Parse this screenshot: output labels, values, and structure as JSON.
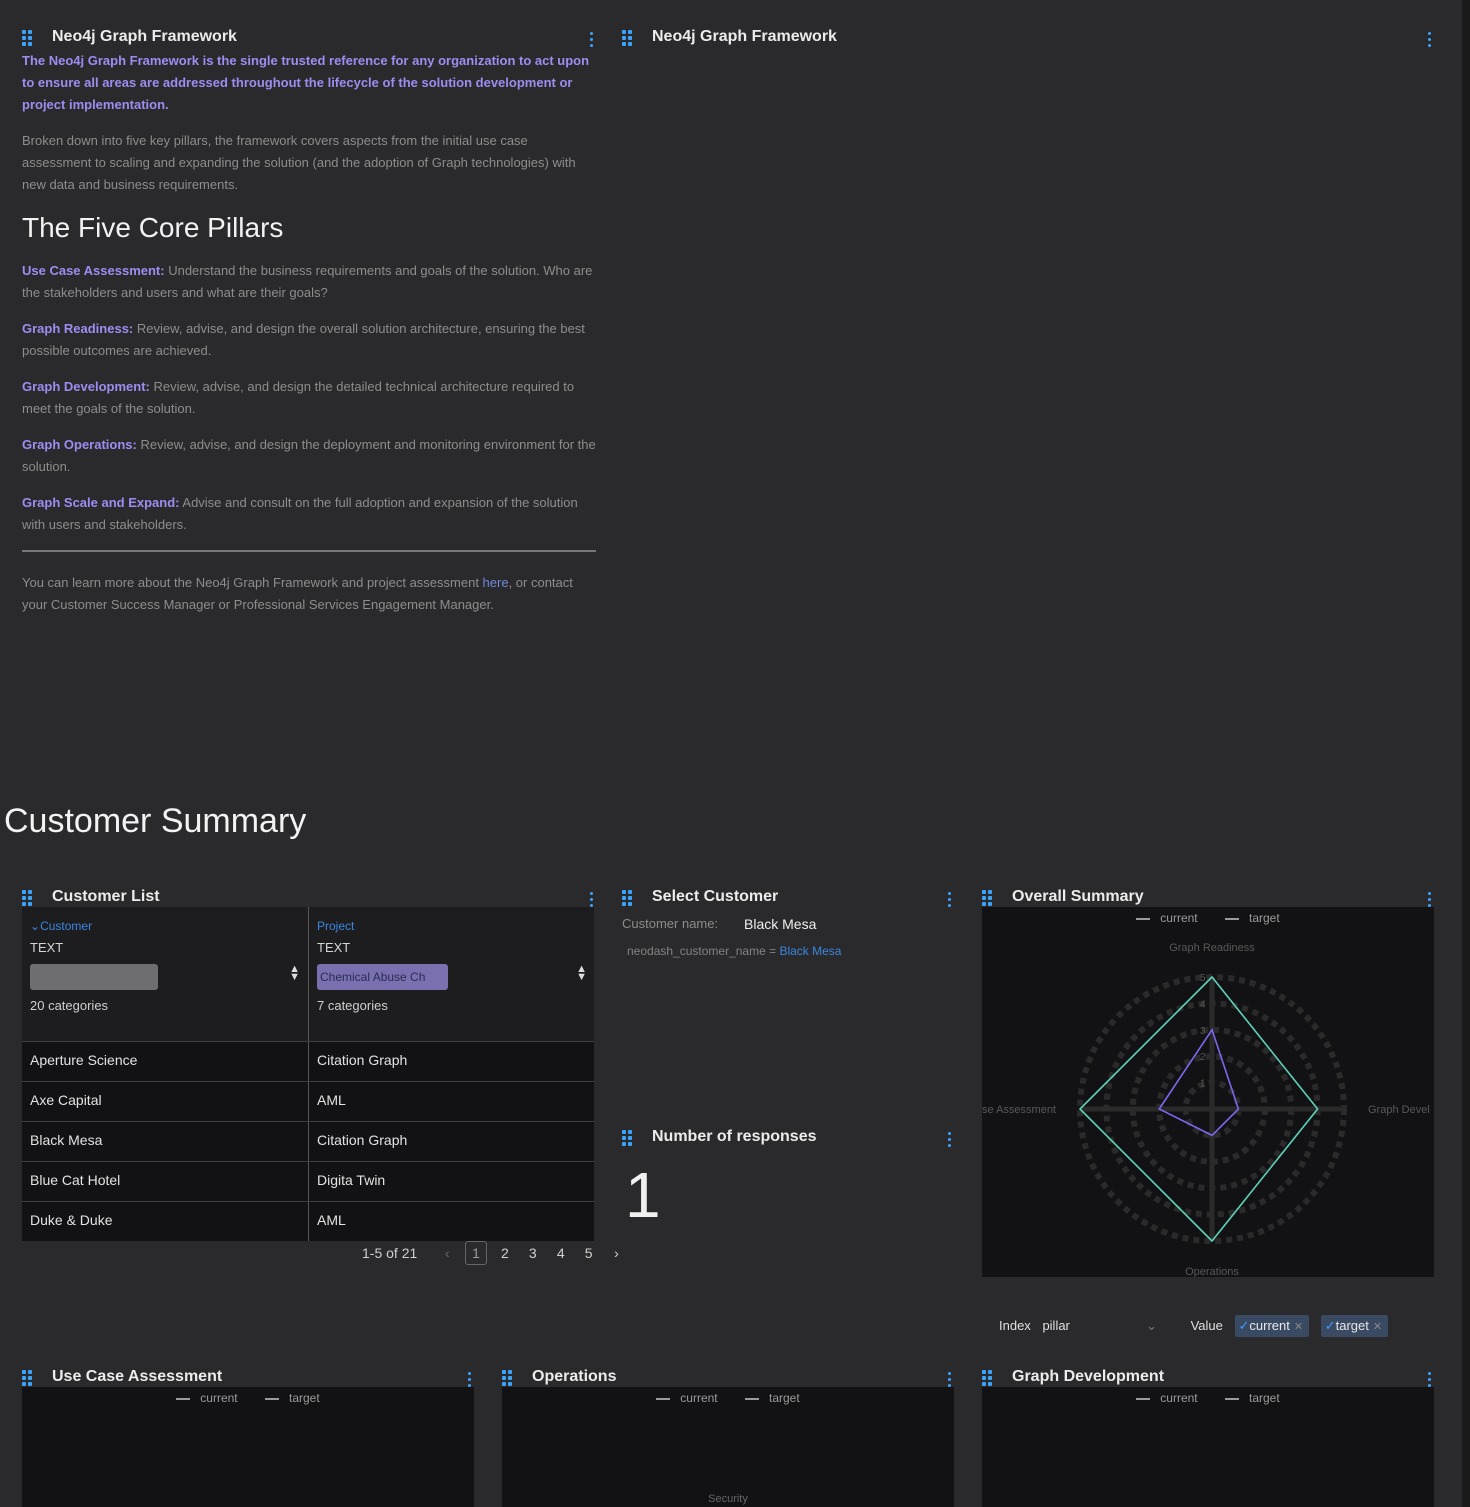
{
  "framework_panel": {
    "title": "Neo4j Graph Framework",
    "lead": "The Neo4j Graph Framework is the single trusted reference for any organization to act upon to ensure all areas are addressed throughout the lifecycle of the solution development or project implementation.",
    "intro": "Broken down into five key pillars, the framework covers aspects from the initial use case assessment to scaling and expanding the solution (and the adoption of Graph technologies) with new data and business requirements.",
    "heading": "The Five Core Pillars",
    "pillars": [
      {
        "name": "Use Case Assessment:",
        "desc": " Understand the business requirements and goals of the solution. Who are the stakeholders and users and what are their goals?"
      },
      {
        "name": "Graph Readiness:",
        "desc": " Review, advise, and design the overall solution architecture, ensuring the best possible outcomes are achieved."
      },
      {
        "name": "Graph Development:",
        "desc": " Review, advise, and design the detailed technical architecture required to meet the goals of the solution."
      },
      {
        "name": "Graph Operations:",
        "desc": " Review, advise, and design the deployment and monitoring environment for the solution."
      },
      {
        "name": "Graph Scale and Expand:",
        "desc": " Advise and consult on the full adoption and expansion of the solution with users and stakeholders."
      }
    ],
    "footer_before": "You can learn more about the Neo4j Graph Framework and project assessment ",
    "footer_link": "here",
    "footer_after": ", or contact your Customer Success Manager or Professional Services Engagement Manager."
  },
  "framework_panel_2": {
    "title": "Neo4j Graph Framework"
  },
  "section_title": "Customer Summary",
  "customer_list": {
    "title": "Customer List",
    "columns": [
      {
        "name": "Customer",
        "type": "TEXT",
        "filter": "",
        "count": "20 categories",
        "sorted": true
      },
      {
        "name": "Project",
        "type": "TEXT",
        "filter": "Chemical Abuse Ch",
        "count": "7 categories",
        "sorted": false
      }
    ],
    "rows": [
      [
        "Aperture Science",
        "Citation Graph"
      ],
      [
        "Axe Capital",
        "AML"
      ],
      [
        "Black Mesa",
        "Citation Graph"
      ],
      [
        "Blue Cat Hotel",
        "Digita Twin"
      ],
      [
        "Duke & Duke",
        "AML"
      ]
    ],
    "pagination": {
      "range": "1-5 of 21",
      "prev": "‹",
      "current": "1",
      "pages": [
        "2",
        "3",
        "4",
        "5"
      ],
      "next": "›"
    }
  },
  "select_customer": {
    "title": "Select Customer",
    "label": "Customer name:",
    "value": "Black Mesa",
    "param_text": "neodash_customer_name = ",
    "param_value": "Black Mesa"
  },
  "responses": {
    "title": "Number of responses",
    "value": "1"
  },
  "overall_summary": {
    "title": "Overall Summary",
    "legend": [
      "current",
      "target"
    ],
    "axes": [
      "Graph Readiness",
      "Graph Development",
      "Operations",
      "Use Case Assessment"
    ],
    "axis_labels_visible": [
      "Graph Readiness",
      "Graph Devel",
      "Operations",
      "se Assessment"
    ],
    "ticks": [
      "5",
      "4",
      "3",
      "2",
      "1"
    ]
  },
  "chart_config": {
    "index_label": "Index",
    "index_value": "pillar",
    "value_label": "Value",
    "values": [
      "current",
      "target"
    ]
  },
  "chart_data": [
    {
      "type": "radar",
      "title": "Overall Summary",
      "axes": [
        "Graph Readiness",
        "Graph Development",
        "Operations",
        "Use Case Assessment"
      ],
      "range": [
        0,
        5
      ],
      "series": [
        {
          "name": "current",
          "values": [
            3,
            1,
            1,
            2
          ],
          "color": "#7b68ee"
        },
        {
          "name": "target",
          "values": [
            5,
            4,
            5,
            5
          ],
          "color": "#5fd3bc"
        }
      ]
    }
  ],
  "bottom_panels": [
    {
      "title": "Use Case Assessment",
      "legend": [
        "current",
        "target"
      ],
      "axis_label": ""
    },
    {
      "title": "Operations",
      "legend": [
        "current",
        "target"
      ],
      "axis_label": "Security"
    },
    {
      "title": "Graph Development",
      "legend": [
        "current",
        "target"
      ],
      "axis_label": ""
    }
  ],
  "colors": {
    "accent": "#3aa4ff",
    "pillar": "#9d8df1",
    "current": "#7b68ee",
    "target": "#5fd3bc"
  }
}
